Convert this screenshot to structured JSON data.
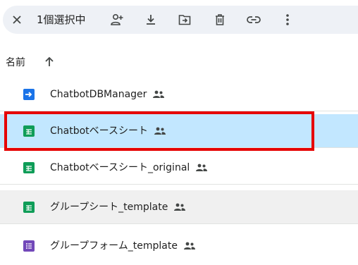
{
  "toolbar": {
    "selection_count": "1個選択中",
    "icons": [
      "close-icon",
      "add-person-icon",
      "download-icon",
      "move-to-folder-icon",
      "trash-icon",
      "link-icon",
      "more-vert-icon"
    ]
  },
  "list_header": {
    "name_label": "名前",
    "sort_direction": "ascending"
  },
  "files": [
    {
      "name": "ChatbotDBManager",
      "type": "apps-script",
      "shared": true,
      "state": "normal"
    },
    {
      "name": "Chatbotベースシート",
      "type": "spreadsheet",
      "shared": true,
      "state": "selected"
    },
    {
      "name": "Chatbotベースシート_original",
      "type": "spreadsheet",
      "shared": true,
      "state": "normal"
    },
    {
      "name": "グループシート_template",
      "type": "spreadsheet",
      "shared": true,
      "state": "hover"
    },
    {
      "name": "グループフォーム_template",
      "type": "form",
      "shared": true,
      "state": "normal"
    }
  ],
  "colors": {
    "toolbar_bg": "#eef1f6",
    "selected_row": "#c2e7ff",
    "hover_row": "#f0f0f0",
    "sheets_green": "#0f9d58",
    "forms_purple": "#7248b9",
    "script_blue": "#1a73e8",
    "highlight_red": "#e60000"
  }
}
